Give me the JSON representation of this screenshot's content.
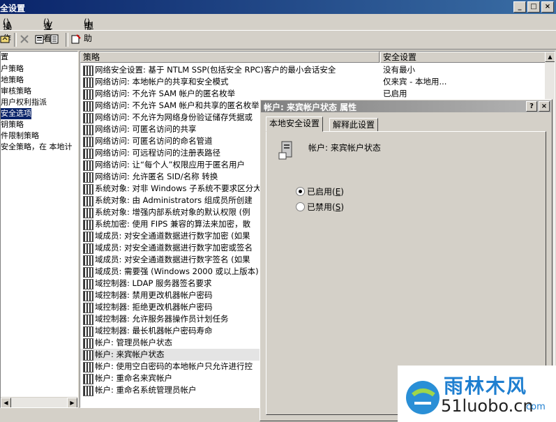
{
  "window": {
    "title": "全设置",
    "controls": [
      "_",
      "□",
      "×"
    ]
  },
  "menu": [
    {
      "label": "操作",
      "key": "A"
    },
    {
      "label": "查看",
      "key": "V"
    },
    {
      "label": "帮助",
      "key": "H"
    }
  ],
  "toolbar": {
    "icons": [
      "folder-up-icon",
      "delete-icon",
      "properties-icon",
      "export-list-icon",
      "help-icon"
    ]
  },
  "tree": {
    "items": [
      "置",
      "户策略",
      "地策略",
      "审核策略",
      "用户权利指派",
      "安全选项",
      "钥策略",
      "件限制策略",
      "安全策略，在 本地计"
    ],
    "selected_index": 5
  },
  "list": {
    "columns": [
      "策略",
      "安全设置"
    ],
    "rows": [
      {
        "policy": "网络安全设置: 基于 NTLM SSP(包括安全 RPC)客户的最小会话安全",
        "value": "没有最小"
      },
      {
        "policy": "网络访问: 本地帐户的共享和安全模式",
        "value": "仅来宾 - 本地用..."
      },
      {
        "policy": "网络访问: 不允许 SAM 帐户的匿名枚举",
        "value": "已启用"
      },
      {
        "policy": "网络访问: 不允许 SAM 帐户和共享的匿名枚举",
        "value": ""
      },
      {
        "policy": "网络访问: 不允许为网络身份验证储存凭据或",
        "value": ""
      },
      {
        "policy": "网络访问: 可匿名访问的共享",
        "value": ""
      },
      {
        "policy": "网络访问: 可匿名访问的命名管道",
        "value": ""
      },
      {
        "policy": "网络访问: 可远程访问的注册表路径",
        "value": ""
      },
      {
        "policy": "网络访问: 让“每个人”权限应用于匿名用户",
        "value": ""
      },
      {
        "policy": "网络访问: 允许匿名 SID/名称 转换",
        "value": ""
      },
      {
        "policy": "系统对象: 对非 Windows 子系统不要求区分大",
        "value": ""
      },
      {
        "policy": "系统对象: 由 Administrators 组成员所创建",
        "value": ""
      },
      {
        "policy": "系统对象: 增强内部系统对象的默认权限 (例",
        "value": ""
      },
      {
        "policy": "系统加密: 使用 FIPS 兼容的算法来加密，散",
        "value": ""
      },
      {
        "policy": "域成员: 对安全通道数据进行数字加密 (如果",
        "value": ""
      },
      {
        "policy": "域成员: 对安全通道数据进行数字加密或签名",
        "value": ""
      },
      {
        "policy": "域成员: 对安全通道数据进行数字签名 (如果",
        "value": ""
      },
      {
        "policy": "域成员: 需要强 (Windows 2000 或以上版本)",
        "value": ""
      },
      {
        "policy": "域控制器: LDAP 服务器签名要求",
        "value": ""
      },
      {
        "policy": "域控制器: 禁用更改机器帐户密码",
        "value": ""
      },
      {
        "policy": "域控制器: 拒绝更改机器帐户密码",
        "value": ""
      },
      {
        "policy": "域控制器: 允许服务器操作员计划任务",
        "value": ""
      },
      {
        "policy": "域控制器: 最长机器帐户密码寿命",
        "value": ""
      },
      {
        "policy": "帐户: 管理员帐户状态",
        "value": ""
      },
      {
        "policy": "帐户: 来宾帐户状态",
        "value": ""
      },
      {
        "policy": "帐户: 使用空白密码的本地帐户只允许进行控",
        "value": ""
      },
      {
        "policy": "帐户: 重命名来宾帐户",
        "value": ""
      },
      {
        "policy": "帐户: 重命名系统管理员帐户",
        "value": ""
      }
    ],
    "selected_index": 24
  },
  "dialog": {
    "title": "帐户: 来宾帐户状态 属性",
    "help_btn": "?",
    "close_btn": "×",
    "tabs": [
      "本地安全设置",
      "解释此设置"
    ],
    "active_tab": 0,
    "policy_name": "帐户: 来宾帐户状态",
    "options": [
      {
        "label": "已启用",
        "key": "E",
        "checked": true
      },
      {
        "label": "已禁用",
        "key": "S",
        "checked": false
      }
    ]
  },
  "watermark": {
    "brand": "雨林木风",
    "url": "51luobo.cn",
    "suffix": "com"
  }
}
